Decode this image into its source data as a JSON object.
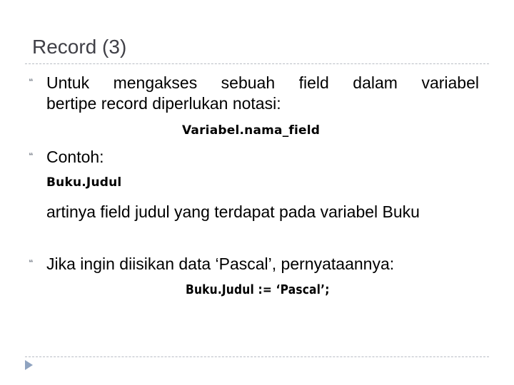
{
  "slide": {
    "title": "Record (3)",
    "bullets": [
      {
        "marker": "bullet-icon",
        "line1": "Untuk mengakses sebuah field dalam variabel",
        "line2": "bertipe record diperlukan notasi:",
        "code": "Variabel.nama_field"
      },
      {
        "marker": "bullet-icon",
        "text": "Contoh:",
        "code": "Buku.Judul",
        "explanation": "artinya field judul yang terdapat pada variabel Buku"
      },
      {
        "marker": "bullet-icon",
        "text": "Jika ingin diisikan data ‘Pascal’, pernyataannya:",
        "code": "Buku.Judul := ‘Pascal’;"
      }
    ],
    "colors": {
      "title": "#404047",
      "rule": "#b8bcc4",
      "nav_arrow": "#8fa3c0"
    }
  }
}
